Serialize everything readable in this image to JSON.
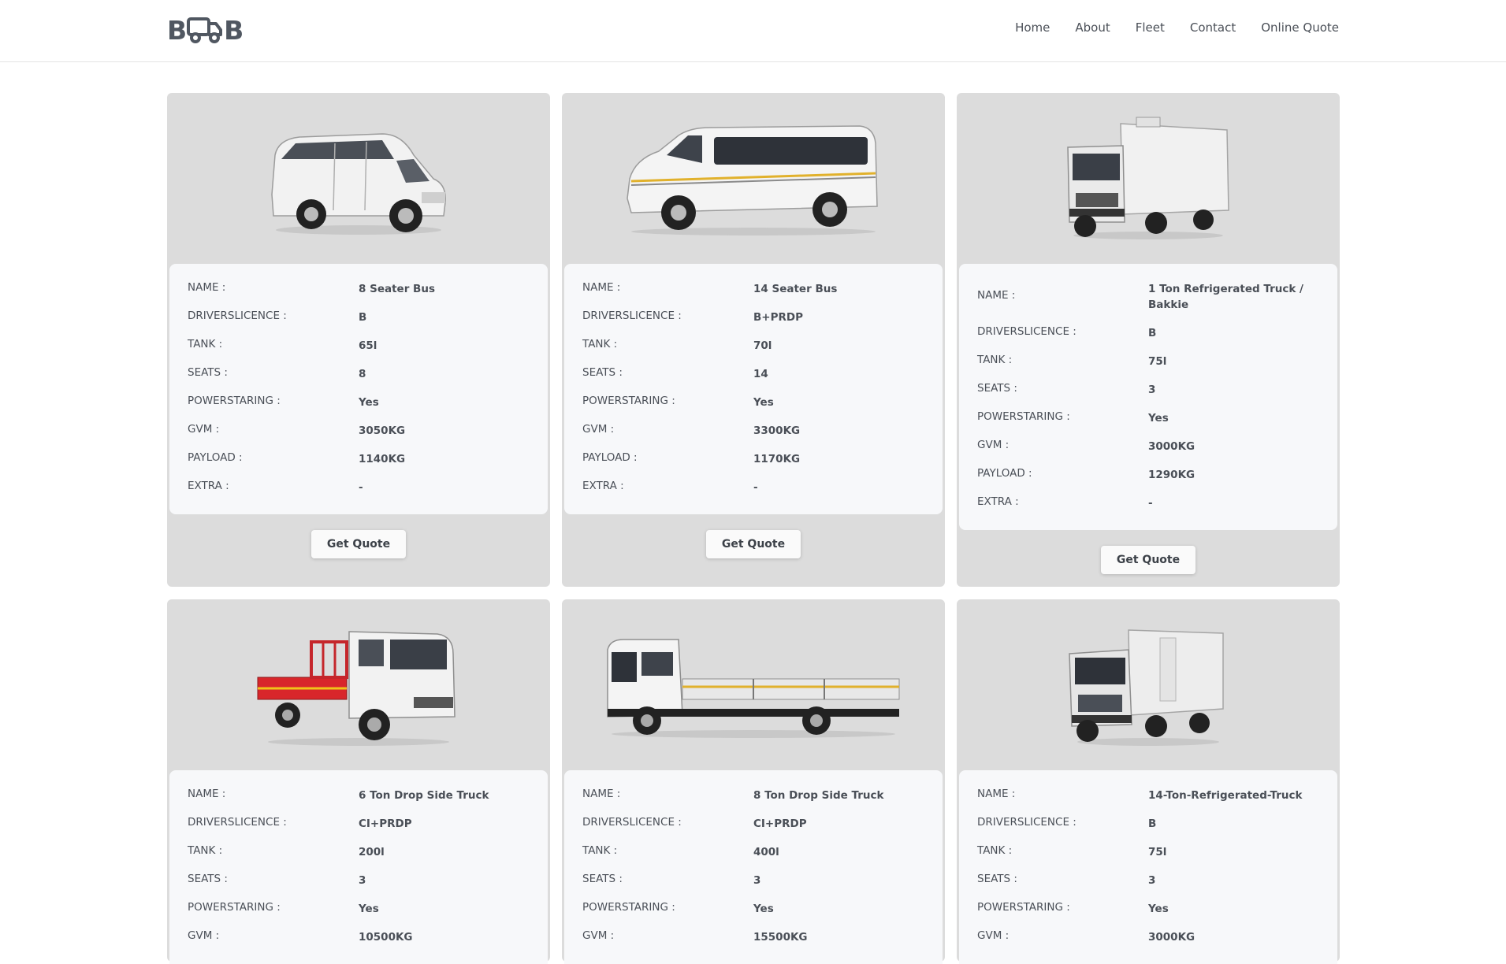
{
  "brand": {
    "logo_left": "B",
    "logo_right": "B"
  },
  "nav": {
    "items": [
      "Home",
      "About",
      "Fleet",
      "Contact",
      "Online Quote"
    ]
  },
  "labels": {
    "name": "NAME :",
    "licence": "DRIVERSLICENCE :",
    "tank": "TANK :",
    "seats": "SEATS :",
    "power": "POWERSTARING :",
    "gvm": "GVM :",
    "payload": "PAYLOAD :",
    "extra": "EXTRA :"
  },
  "button_label": "Get Quote",
  "vehicles": [
    {
      "name": "8 Seater Bus",
      "licence": "B",
      "tank": "65l",
      "seats": "8",
      "power": "Yes",
      "gvm": "3050KG",
      "payload": "1140KG",
      "extra": "-"
    },
    {
      "name": "14 Seater Bus",
      "licence": "B+PRDP",
      "tank": "70l",
      "seats": "14",
      "power": "Yes",
      "gvm": "3300KG",
      "payload": "1170KG",
      "extra": "-"
    },
    {
      "name": "1 Ton Refrigerated Truck / Bakkie",
      "licence": "B",
      "tank": "75l",
      "seats": "3",
      "power": "Yes",
      "gvm": "3000KG",
      "payload": "1290KG",
      "extra": "-"
    },
    {
      "name": "6 Ton Drop Side Truck",
      "licence": "CI+PRDP",
      "tank": "200l",
      "seats": "3",
      "power": "Yes",
      "gvm": "10500KG"
    },
    {
      "name": "8 Ton Drop Side Truck",
      "licence": "CI+PRDP",
      "tank": "400l",
      "seats": "3",
      "power": "Yes",
      "gvm": "15500KG"
    },
    {
      "name": "14-Ton-Refrigerated-Truck",
      "licence": "B",
      "tank": "75l",
      "seats": "3",
      "power": "Yes",
      "gvm": "3000KG"
    }
  ],
  "images": [
    "minivan-image",
    "minibus-image",
    "refrigerated-truck-image",
    "red-dropside-truck-image",
    "flatbed-truck-image",
    "box-truck-image"
  ]
}
